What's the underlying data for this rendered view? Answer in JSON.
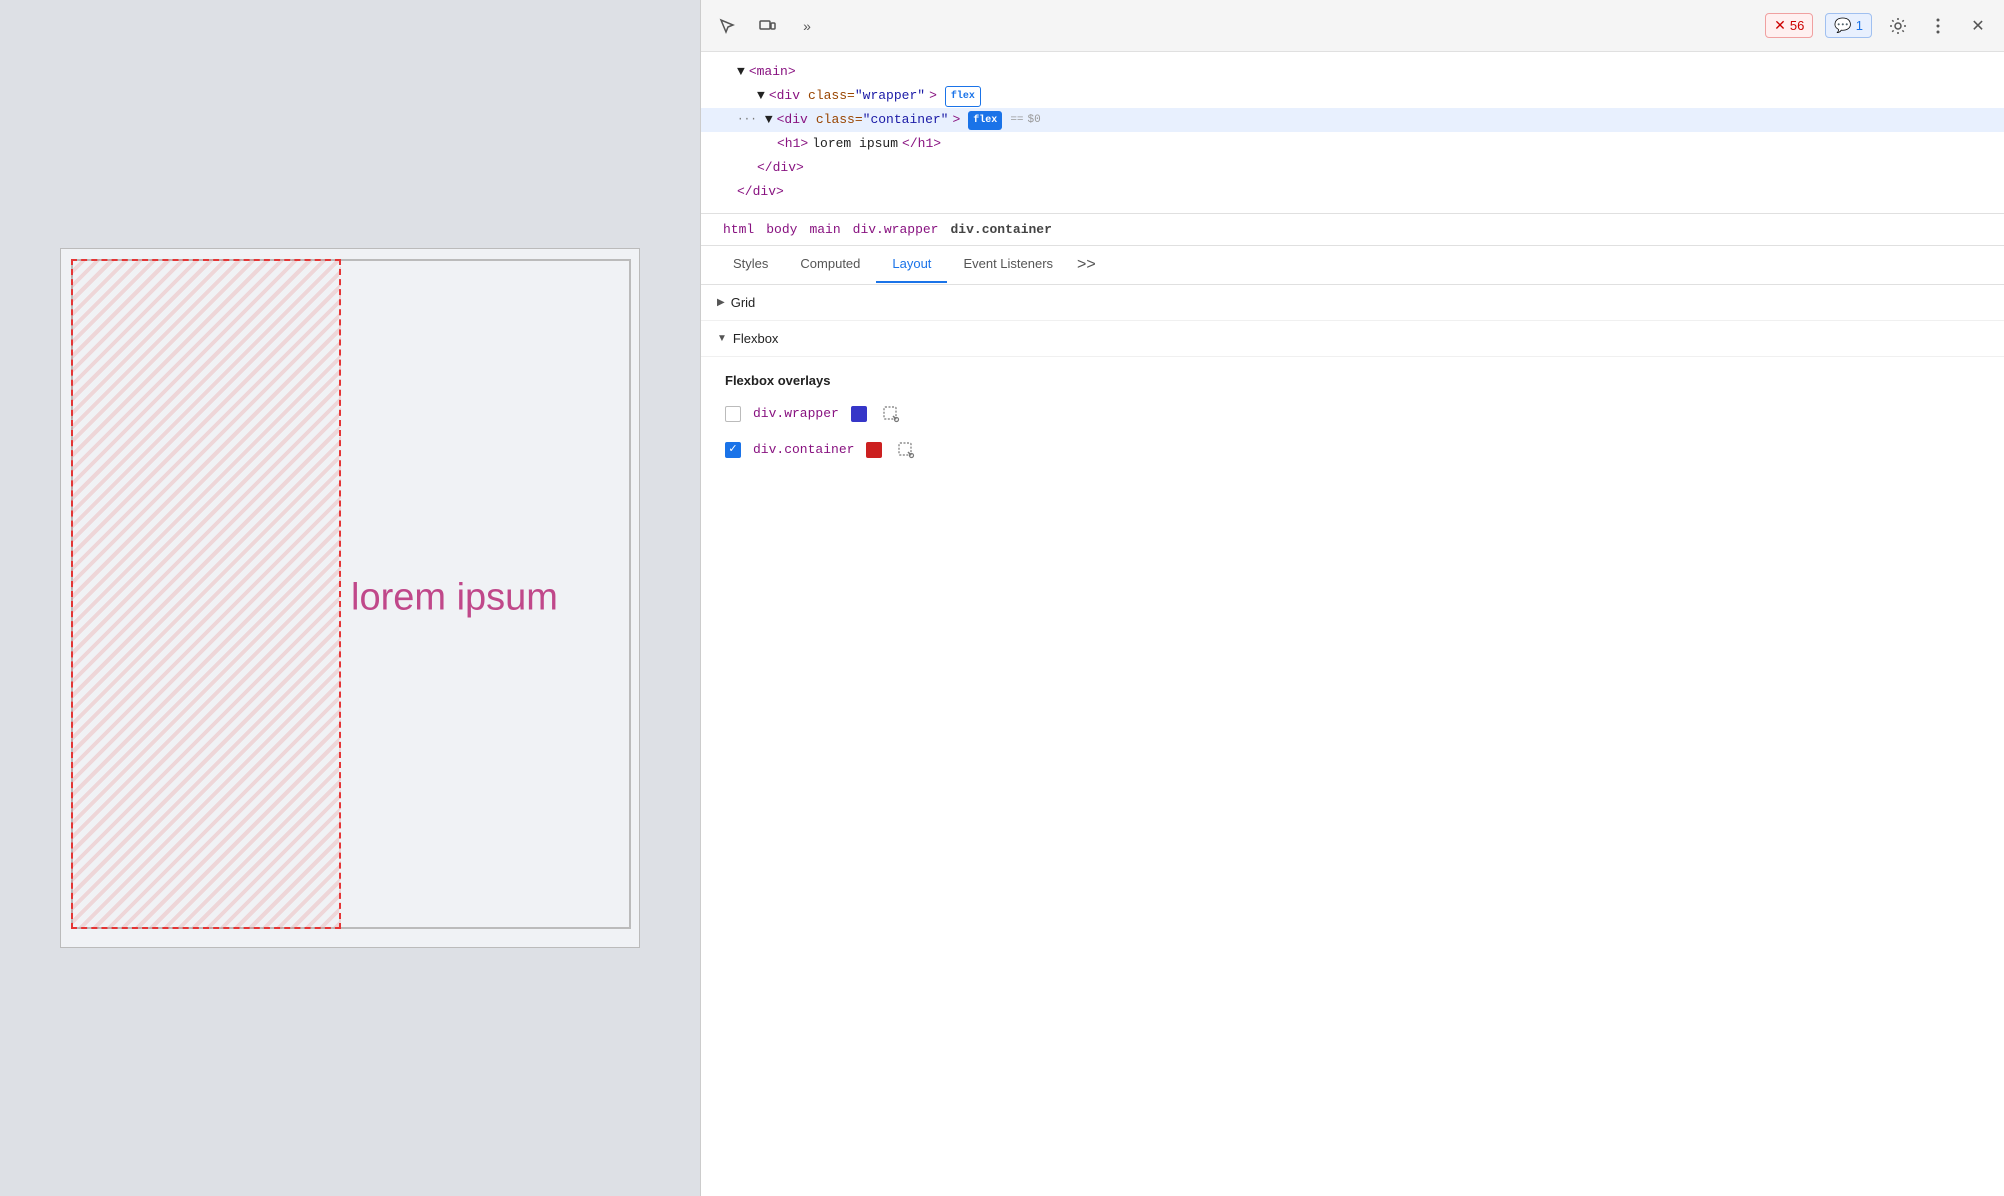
{
  "preview": {
    "lorem_text": "lorem ipsum"
  },
  "devtools": {
    "toolbar": {
      "inspect_icon": "⊡",
      "responsive_icon": "⧉",
      "more_icon": "»",
      "error_badge": "56",
      "info_badge": "1",
      "settings_icon": "⚙",
      "menu_icon": "⋮",
      "close_icon": "✕"
    },
    "dom_tree": {
      "lines": [
        {
          "indent": 2,
          "content": "▼<main>",
          "selected": false
        },
        {
          "indent": 3,
          "content": "▼<div class=\"wrapper\">",
          "badge": "flex",
          "badgeStyle": "outline",
          "selected": false
        },
        {
          "indent": 2,
          "ellipsis": true,
          "content": "▼<div class=\"container\">",
          "badge": "flex",
          "badgeStyle": "filled",
          "equals": "== $0",
          "selected": true
        },
        {
          "indent": 4,
          "content": "<h1>lorem ipsum</h1>",
          "selected": false
        },
        {
          "indent": 4,
          "content": "</div>",
          "selected": false
        },
        {
          "indent": 3,
          "content": "</div>",
          "selected": false
        }
      ]
    },
    "breadcrumb": {
      "items": [
        "html",
        "body",
        "main",
        "div.wrapper",
        "div.container"
      ]
    },
    "tabs": {
      "items": [
        "Styles",
        "Computed",
        "Layout",
        "Event Listeners"
      ],
      "active": "Layout",
      "more": ">>"
    },
    "layout": {
      "grid_section": {
        "title": "Grid",
        "collapsed": true
      },
      "flexbox_section": {
        "title": "Flexbox",
        "collapsed": false,
        "overlays_title": "Flexbox overlays",
        "rows": [
          {
            "checked": false,
            "label": "div.wrapper",
            "color": "#3636c8",
            "has_icon": true
          },
          {
            "checked": true,
            "label": "div.container",
            "color": "#cc2020",
            "has_icon": true
          }
        ]
      }
    }
  }
}
